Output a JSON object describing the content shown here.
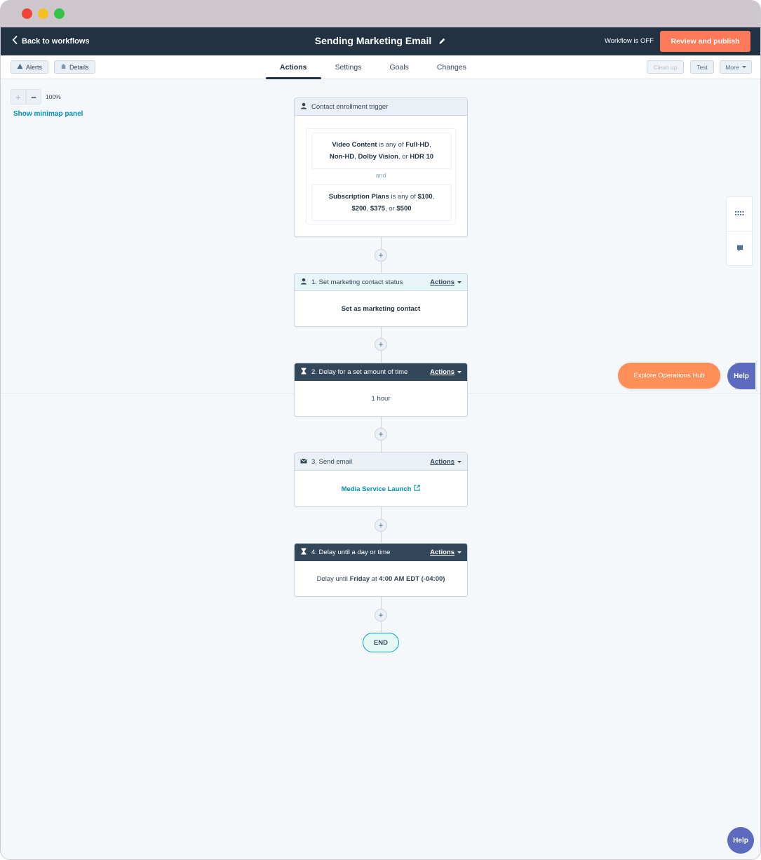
{
  "nav": {
    "back_label": "Back to workflows",
    "workflow_title": "Sending Marketing Email",
    "workflow_status": "Workflow is OFF",
    "publish_label": "Review and publish"
  },
  "subnav": {
    "alerts_label": "Alerts",
    "details_label": "Details",
    "tabs": [
      {
        "label": "Actions",
        "active": true
      },
      {
        "label": "Settings",
        "active": false
      },
      {
        "label": "Goals",
        "active": false
      },
      {
        "label": "Changes",
        "active": false
      }
    ],
    "cleanup_label": "Clean up",
    "test_label": "Test",
    "more_label": "More"
  },
  "canvas": {
    "zoom_level": "100%",
    "minimap_label": "Show minimap panel"
  },
  "trigger": {
    "title": "Contact enrollment trigger",
    "condition1": {
      "property": "Video Content",
      "operator": " is any of ",
      "v1": "Full-HD",
      "v2": "Non-HD",
      "v3": "Dolby Vision",
      "v4": "HDR 10",
      "sep_comma": ", ",
      "sep_or": ", or "
    },
    "and_label": "and",
    "condition2": {
      "property": "Subscription Plans",
      "operator": " is any of ",
      "v1": "$100",
      "v2": "$200",
      "v3": "$375",
      "v4": "$500",
      "sep_comma": ", ",
      "sep_or": ", or "
    }
  },
  "actions_label": "Actions",
  "steps": [
    {
      "title": "1. Set marketing contact status",
      "body": "Set as marketing contact"
    },
    {
      "title": "2. Delay for a set amount of time",
      "body": "1 hour"
    },
    {
      "title": "3. Send email",
      "body": "Media Service Launch"
    },
    {
      "title": "4. Delay until a day or time",
      "body_prefix": "Delay until ",
      "day": "Friday",
      "at": " at ",
      "time": "4:00 AM EDT (-04:00)"
    }
  ],
  "add_symbol": "+",
  "end_label": "END",
  "explore_label": "Explore Operations Hub",
  "help_label": "Help",
  "colors": {
    "nav_bg": "#213343",
    "accent_orange": "#ff7a59",
    "link_teal": "#0091ae",
    "help_purple": "#5c6bc0"
  }
}
